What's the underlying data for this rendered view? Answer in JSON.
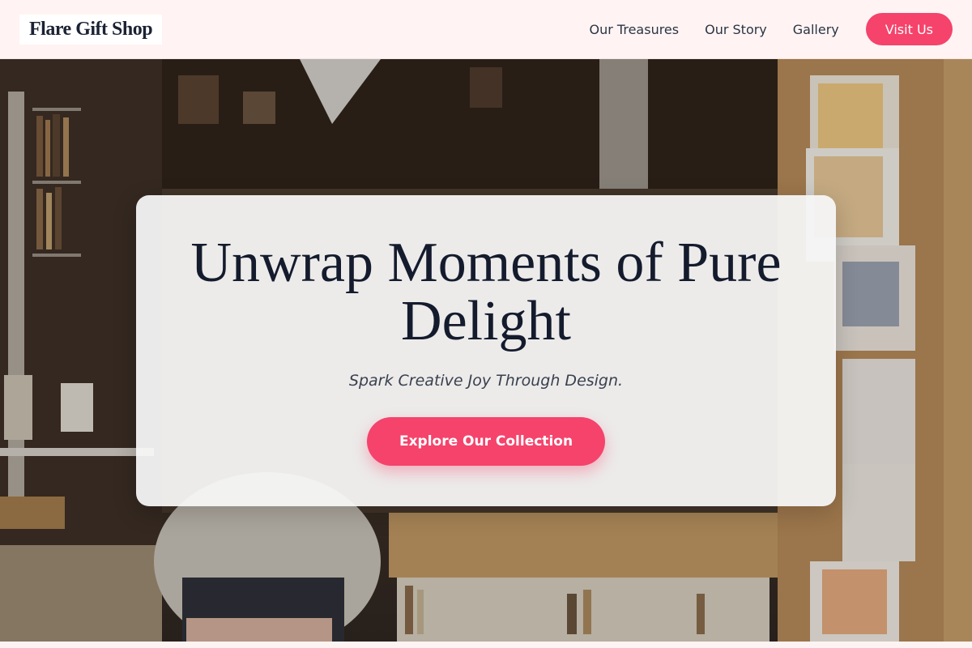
{
  "header": {
    "logo": "Flare Gift Shop",
    "nav": [
      {
        "label": "Our Treasures"
      },
      {
        "label": "Our Story"
      },
      {
        "label": "Gallery"
      }
    ],
    "cta_label": "Visit Us"
  },
  "hero": {
    "headline": "Unwrap Moments of Pure Delight",
    "tagline": "Spark Creative Joy Through Design.",
    "cta_label": "Explore Our Collection"
  },
  "colors": {
    "accent": "#f5436b",
    "header_bg": "#fff4f3",
    "heading_text": "#141b2d"
  }
}
